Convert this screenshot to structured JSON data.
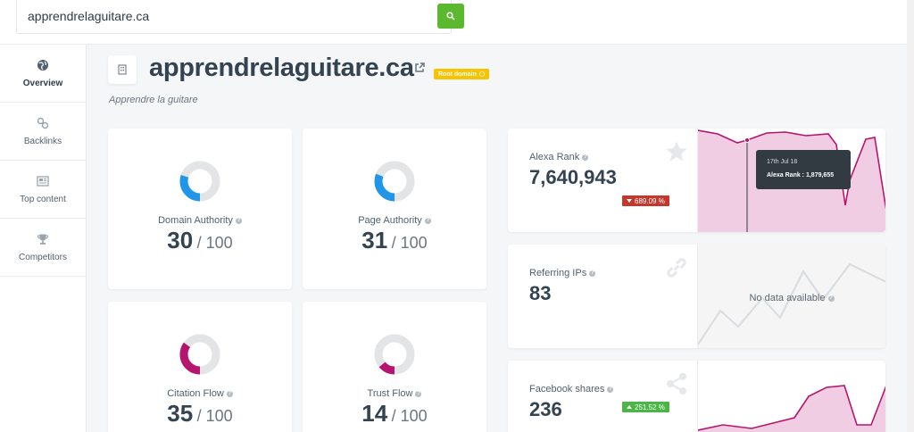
{
  "search": {
    "value": "apprendrelaguitare.ca"
  },
  "sidebar": {
    "items": [
      {
        "label": "Overview"
      },
      {
        "label": "Backlinks"
      },
      {
        "label": "Top content"
      },
      {
        "label": "Competitors"
      }
    ]
  },
  "header": {
    "domain": "apprendrelaguitare.ca",
    "badge": "Root domain",
    "subtitle": "Apprendre la guitare"
  },
  "metrics": [
    {
      "label": "Domain Authority",
      "value": "30",
      "max": "/ 100",
      "fraction": 0.3,
      "color": "#2196e8"
    },
    {
      "label": "Page Authority",
      "value": "31",
      "max": "/ 100",
      "fraction": 0.31,
      "color": "#2196e8"
    },
    {
      "label": "Citation Flow",
      "value": "35",
      "max": "/ 100",
      "fraction": 0.35,
      "color": "#b5156f"
    },
    {
      "label": "Trust Flow",
      "value": "14",
      "max": "/ 100",
      "fraction": 0.14,
      "color": "#b5156f"
    }
  ],
  "stats": {
    "alexa": {
      "label": "Alexa Rank",
      "value": "7,640,943",
      "delta": "689.09 %",
      "tooltip_date": "17th Jul 18",
      "tooltip_value": "Alexa Rank : 1,879,655"
    },
    "referring": {
      "label": "Referring IPs",
      "value": "83",
      "nodata": "No data available"
    },
    "facebook": {
      "label": "Facebook shares",
      "value": "236",
      "delta": "251.52 %"
    }
  },
  "colors": {
    "accent_green": "#5cb82e",
    "magenta": "#b5156f",
    "blue": "#2196e8",
    "badge": "#f9c300"
  }
}
